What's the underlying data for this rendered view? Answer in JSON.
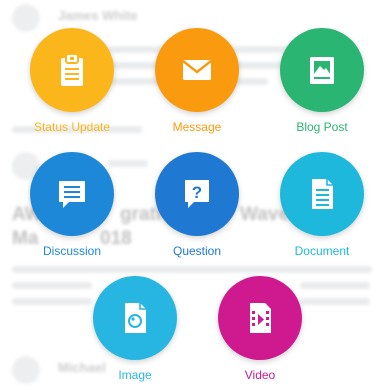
{
  "colors": {
    "status_update": "#fbb61b",
    "message": "#f99a0f",
    "blog_post": "#2bb573",
    "discussion": "#1e88d8",
    "question": "#1f78d1",
    "document": "#1fb8dd",
    "image": "#27b6e1",
    "video": "#cf1a8f"
  },
  "actions": {
    "status_update": {
      "label": "Status Update",
      "icon": "clipboard-icon"
    },
    "message": {
      "label": "Message",
      "icon": "envelope-icon"
    },
    "blog_post": {
      "label": "Blog Post",
      "icon": "picture-frame-icon"
    },
    "discussion": {
      "label": "Discussion",
      "icon": "speech-bubble-icon"
    },
    "question": {
      "label": "Question",
      "icon": "question-bubble-icon"
    },
    "document": {
      "label": "Document",
      "icon": "document-icon"
    },
    "image": {
      "label": "Image",
      "icon": "image-file-icon"
    },
    "video": {
      "label": "Video",
      "icon": "film-icon"
    }
  },
  "background_feed": {
    "author_1": "James White",
    "author_2": "Michael",
    "post_title_1": "AW",
    "post_title_2": "grati",
    "post_title_3": "Wave",
    "post_title_4": "Ma",
    "post_title_5": "018"
  }
}
